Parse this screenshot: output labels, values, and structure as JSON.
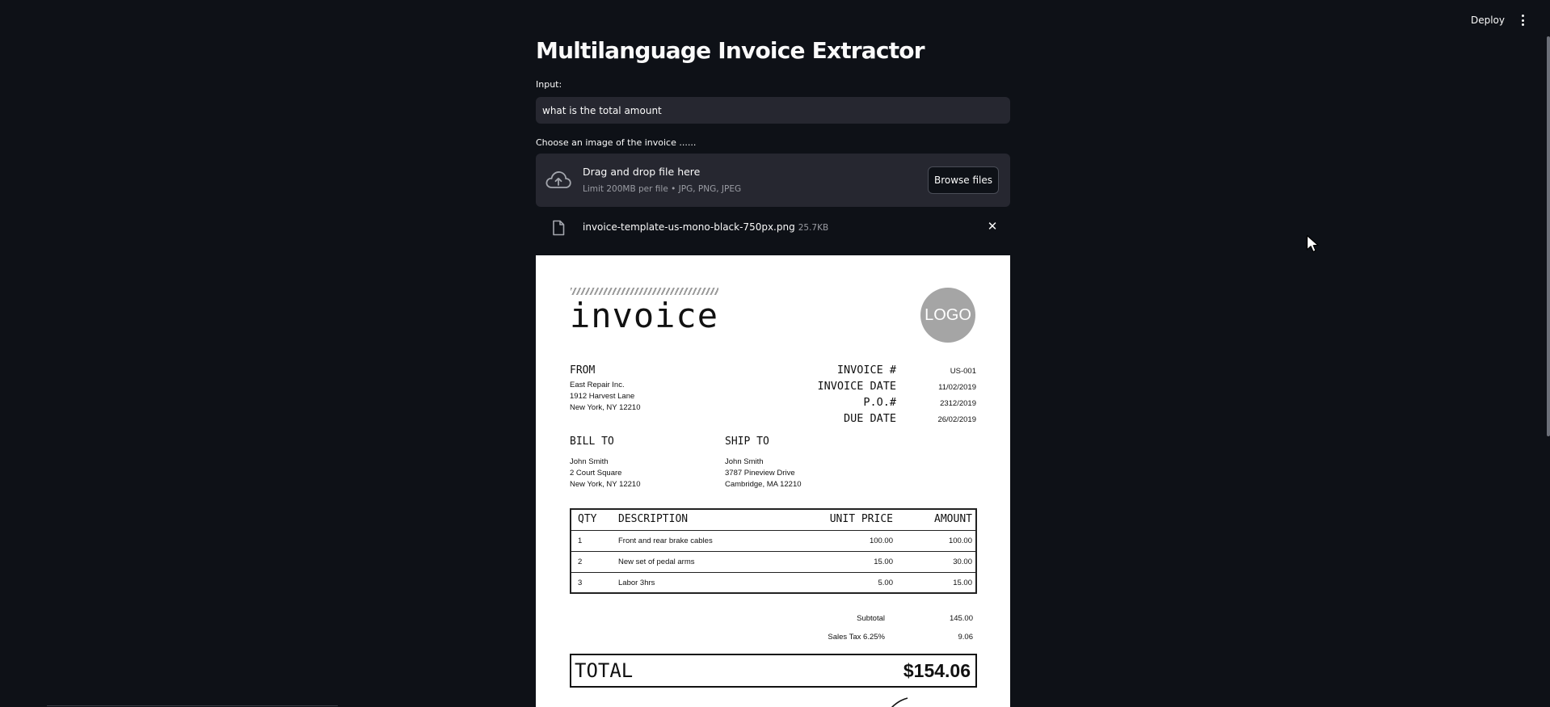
{
  "header": {
    "deploy_label": "Deploy",
    "menu_icon": "kebab-menu-icon"
  },
  "app": {
    "title": "Multilanguage Invoice Extractor"
  },
  "input": {
    "label": "Input:",
    "value": "what is the total amount"
  },
  "uploader": {
    "label": "Choose an image of the invoice ......",
    "drop_title": "Drag and drop file here",
    "limit_text": "Limit 200MB per file • JPG, PNG, JPEG",
    "browse_label": "Browse files",
    "icon": "cloud-upload-icon"
  },
  "uploaded_file": {
    "name": "invoice-template-us-mono-black-750px.png",
    "size": "25.7KB",
    "icon": "file-icon",
    "close_icon": "close-icon"
  },
  "invoice": {
    "heading": "invoice",
    "logo_text": "LOGO",
    "from_label": "FROM",
    "from_lines": [
      "East Repair Inc.",
      "1912 Harvest Lane",
      "New York, NY 12210"
    ],
    "meta": [
      {
        "key": "INVOICE #",
        "value": "US-001"
      },
      {
        "key": "INVOICE DATE",
        "value": "11/02/2019"
      },
      {
        "key": "P.O.#",
        "value": "2312/2019"
      },
      {
        "key": "DUE DATE",
        "value": "26/02/2019"
      }
    ],
    "bill_to_label": "BILL TO",
    "bill_to_lines": [
      "John Smith",
      "2 Court Square",
      "New York, NY 12210"
    ],
    "ship_to_label": "SHIP TO",
    "ship_to_lines": [
      "John Smith",
      "3787 Pineview Drive",
      "Cambridge, MA 12210"
    ],
    "columns": [
      "QTY",
      "DESCRIPTION",
      "UNIT PRICE",
      "AMOUNT"
    ],
    "items": [
      {
        "qty": "1",
        "description": "Front and rear brake cables",
        "unit_price": "100.00",
        "amount": "100.00"
      },
      {
        "qty": "2",
        "description": "New set of pedal arms",
        "unit_price": "15.00",
        "amount": "30.00"
      },
      {
        "qty": "3",
        "description": "Labor 3hrs",
        "unit_price": "5.00",
        "amount": "15.00"
      }
    ],
    "subtotal_label": "Subtotal",
    "subtotal_value": "145.00",
    "tax_label": "Sales Tax 6.25%",
    "tax_value": "9.06",
    "total_label": "TOTAL",
    "total_value": "$154.06"
  },
  "colors": {
    "background": "#0e1117",
    "input_bg": "#262730",
    "text": "#fafafa",
    "muted": "#9a9ca3"
  }
}
